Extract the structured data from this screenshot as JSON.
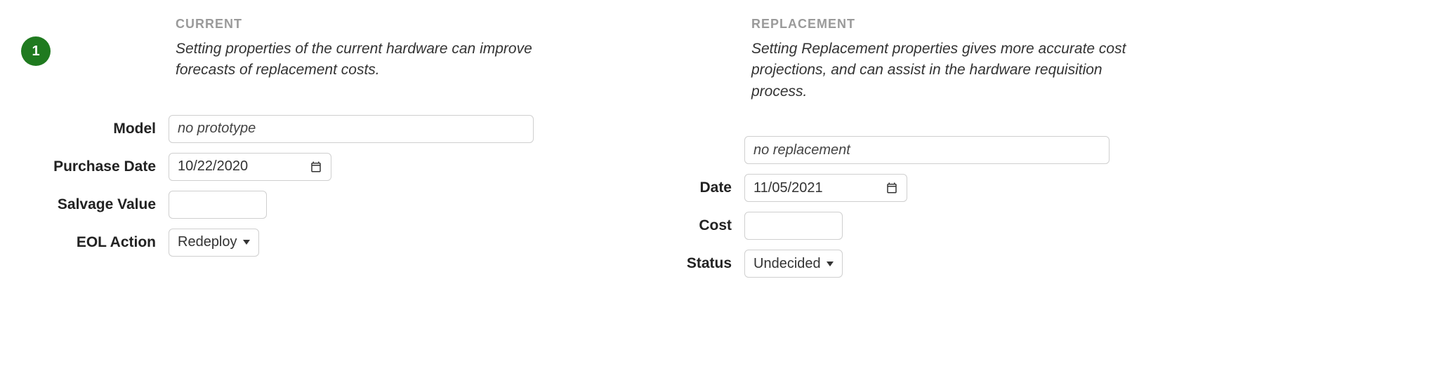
{
  "step_badge": "1",
  "current": {
    "heading": "CURRENT",
    "description": "Setting properties of the current hardware can improve forecasts of replacement costs.",
    "model_label": "Model",
    "model_value": "no prototype",
    "purchase_date_label": "Purchase Date",
    "purchase_date_value": "10/22/2020",
    "salvage_label": "Salvage Value",
    "salvage_value": "",
    "eol_label": "EOL Action",
    "eol_value": "Redeploy"
  },
  "replacement": {
    "heading": "REPLACEMENT",
    "description": "Setting Replacement properties gives more accurate cost projections, and can assist in the hardware requisition process.",
    "model_value": "no replacement",
    "date_label": "Date",
    "date_value": "11/05/2021",
    "cost_label": "Cost",
    "cost_value": "",
    "status_label": "Status",
    "status_value": "Undecided"
  }
}
